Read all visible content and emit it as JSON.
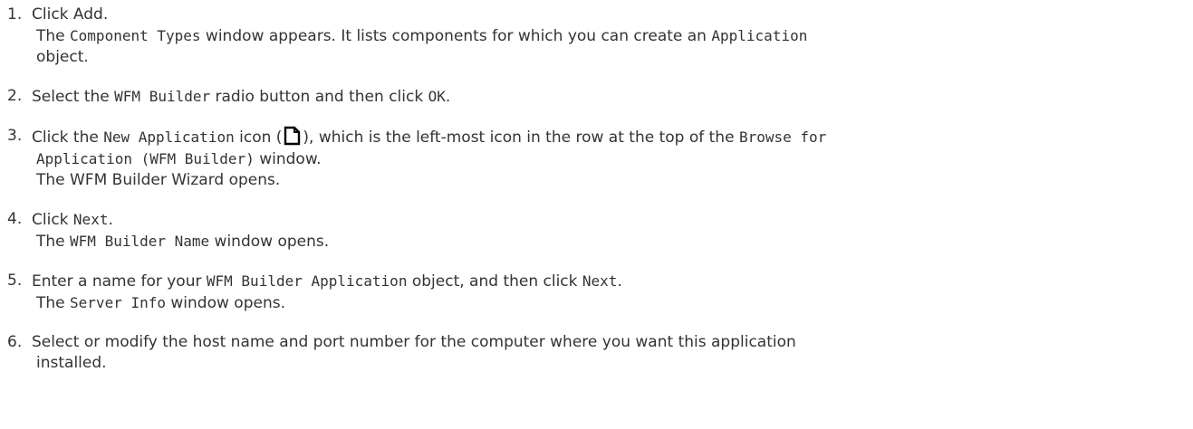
{
  "steps": [
    {
      "number": "1.",
      "lines": [
        [
          "Click Add."
        ],
        [
          "The ",
          "Component Types",
          " window appears. It lists components for which you can create an ",
          "Application"
        ],
        [
          "object."
        ]
      ]
    },
    {
      "number": "2.",
      "lines": [
        [
          "Select the ",
          "WFM Builder",
          " radio button and then click ",
          "OK",
          "."
        ]
      ]
    },
    {
      "number": "3.",
      "icon": "new-document-icon",
      "lines": [
        [
          "Click the ",
          "New Application",
          " icon (",
          ")",
          ", which is the left-most icon in the row at the top of the ",
          "Browse for"
        ],
        [
          "Application (WFM Builder)",
          " window."
        ],
        [
          "The WFM Builder Wizard opens."
        ]
      ]
    },
    {
      "number": "4.",
      "lines": [
        [
          "Click ",
          "Next",
          "."
        ],
        [
          "The ",
          "WFM Builder Name",
          " window opens."
        ]
      ]
    },
    {
      "number": "5.",
      "lines": [
        [
          "Enter a name for your ",
          "WFM Builder Application",
          " object, and then click ",
          "Next",
          "."
        ],
        [
          "The ",
          "Server Info",
          " window opens."
        ]
      ]
    },
    {
      "number": "6.",
      "lines": [
        [
          "Select or modify the host name and port number for the computer where you want this application"
        ],
        [
          "installed."
        ]
      ]
    }
  ]
}
